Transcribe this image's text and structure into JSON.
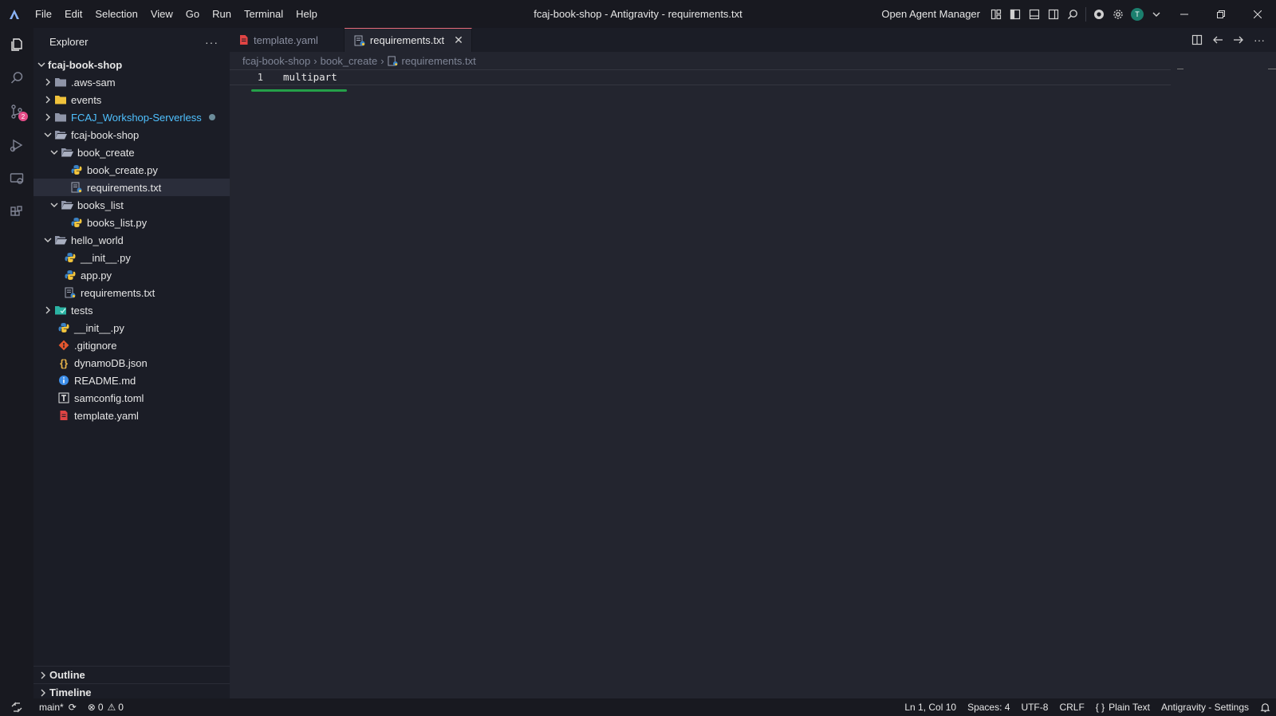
{
  "titlebar": {
    "menu": [
      "File",
      "Edit",
      "Selection",
      "View",
      "Go",
      "Run",
      "Terminal",
      "Help"
    ],
    "window_title": "fcaj-book-shop - Antigravity - requirements.txt",
    "agent_manager": "Open Agent Manager",
    "avatar_initial": "T"
  },
  "activitybar": {
    "scm_badge": "2"
  },
  "sidebar": {
    "title": "Explorer",
    "root": "fcaj-book-shop",
    "tree": [
      {
        "label": ".aws-sam",
        "icon": "folder-icon"
      },
      {
        "label": "events",
        "icon": "folder-icon"
      },
      {
        "label": "FCAJ_Workshop-Serverless",
        "icon": "folder-icon"
      },
      {
        "label": "fcaj-book-shop",
        "icon": "folder-open-icon"
      },
      {
        "label": "book_create",
        "icon": "folder-open-icon"
      },
      {
        "label": "book_create.py",
        "icon": "python-file-icon"
      },
      {
        "label": "requirements.txt",
        "icon": "requirements-file-icon"
      },
      {
        "label": "books_list",
        "icon": "folder-open-icon"
      },
      {
        "label": "books_list.py",
        "icon": "python-file-icon"
      },
      {
        "label": "hello_world",
        "icon": "folder-open-icon"
      },
      {
        "label": "__init__.py",
        "icon": "python-file-icon"
      },
      {
        "label": "app.py",
        "icon": "python-file-icon"
      },
      {
        "label": "requirements.txt",
        "icon": "requirements-file-icon"
      },
      {
        "label": "tests",
        "icon": "test-folder-icon"
      },
      {
        "label": "__init__.py",
        "icon": "python-file-icon"
      },
      {
        "label": ".gitignore",
        "icon": "git-icon"
      },
      {
        "label": "dynamoDB.json",
        "icon": "json-icon"
      },
      {
        "label": "README.md",
        "icon": "info-icon"
      },
      {
        "label": "samconfig.toml",
        "icon": "toml-icon"
      },
      {
        "label": "template.yaml",
        "icon": "yaml-icon"
      }
    ],
    "outline": "Outline",
    "timeline": "Timeline"
  },
  "tabs": [
    {
      "label": "template.yaml",
      "active": false
    },
    {
      "label": "requirements.txt",
      "active": true
    }
  ],
  "breadcrumb": [
    "fcaj-book-shop",
    "book_create",
    "requirements.txt"
  ],
  "editor": {
    "lines": [
      {
        "num": "1",
        "text": "multipart"
      }
    ]
  },
  "statusbar": {
    "branch": "main*",
    "errors": "0",
    "warnings": "0",
    "position": "Ln 1, Col 10",
    "spaces": "Spaces: 4",
    "encoding": "UTF-8",
    "eol": "CRLF",
    "language": "Plain Text",
    "settings": "Antigravity - Settings"
  },
  "colors": {
    "accent_tab": "#e66a7a",
    "squiggle": "#25a049",
    "badge": "#e54b87",
    "folder_highlight": "#4fc1ff"
  }
}
